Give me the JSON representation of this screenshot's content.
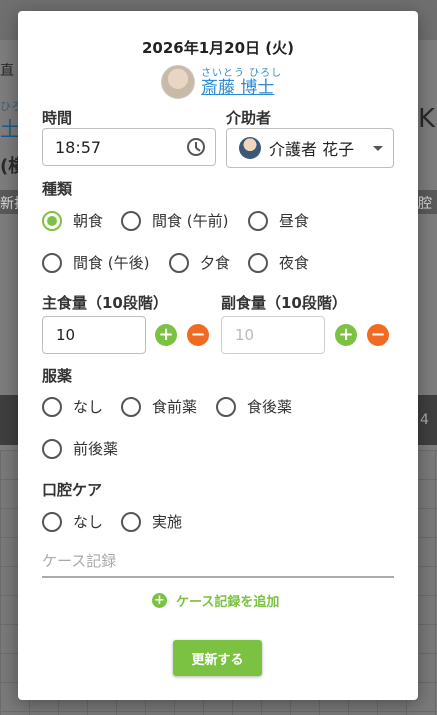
{
  "background": {
    "left_texts": [
      "直 >",
      "ひろ",
      "土",
      "(横",
      "新排"
    ],
    "right_texts": [
      "K)",
      "腔",
      "4"
    ]
  },
  "modal": {
    "date": "2026年1月20日 (火)",
    "resident": {
      "ruby": "さいとう ひろし",
      "name": "斎藤 博士"
    },
    "time": {
      "label": "時間",
      "value": "18:57"
    },
    "helper": {
      "label": "介助者",
      "value": "介護者 花子"
    },
    "meal_type": {
      "label": "種類",
      "options": [
        "朝食",
        "間食 (午前)",
        "昼食",
        "間食 (午後)",
        "夕食",
        "夜食"
      ],
      "selected": "朝食"
    },
    "main_amount": {
      "label": "主食量（10段階）",
      "value": "10"
    },
    "side_amount": {
      "label": "副食量（10段階）",
      "placeholder": "10"
    },
    "medication": {
      "label": "服薬",
      "options": [
        "なし",
        "食前薬",
        "食後薬",
        "前後薬"
      ]
    },
    "oral_care": {
      "label": "口腔ケア",
      "options": [
        "なし",
        "実施"
      ]
    },
    "case_record": {
      "placeholder": "ケース記録",
      "add_label": "ケース記録を追加"
    },
    "update_label": "更新する",
    "colors": {
      "accent": "#7cc242",
      "minus": "#f26a21",
      "link": "#2d8bd6"
    }
  }
}
